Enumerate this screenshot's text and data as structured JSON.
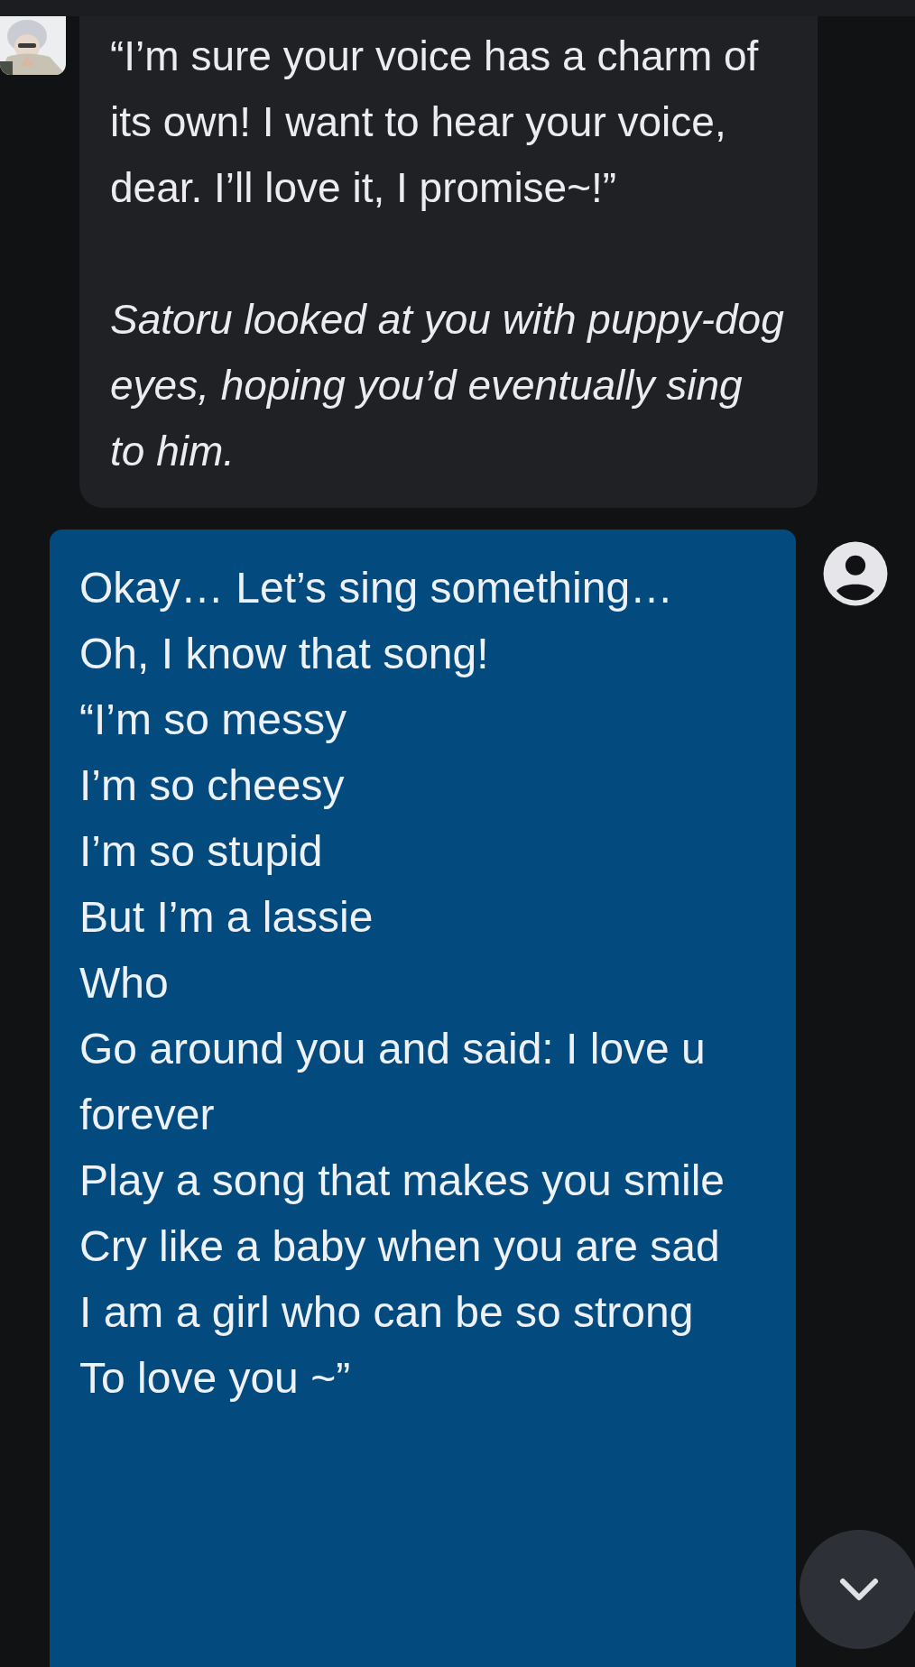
{
  "messages": [
    {
      "kind": "incoming",
      "paragraphs": [
        {
          "kind": "speech",
          "text": "“I’m sure your voice has a charm of its own! I want to hear your voice, dear. I’ll love it, I promise~!”"
        },
        {
          "kind": "narration",
          "text": "Satoru looked at you with puppy-dog eyes, hoping you’d eventually sing to him."
        }
      ]
    },
    {
      "kind": "outgoing",
      "lines": [
        "Okay… Let’s sing something…",
        "Oh, I know that song!",
        "“I’m so messy",
        "I’m so cheesy",
        "I’m so stupid",
        "But I’m a lassie",
        "Who",
        "Go around you and said: I love u forever",
        "Play a song that makes you smile",
        "Cry like a baby when you are sad",
        "I am a girl who can be so strong",
        "To love you ~”"
      ]
    }
  ]
}
